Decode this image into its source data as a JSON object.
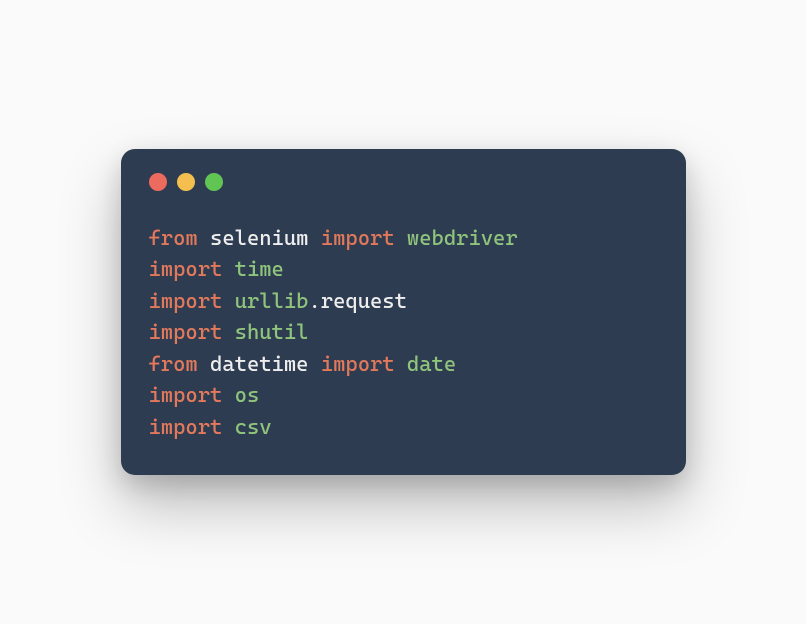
{
  "code": {
    "lines": [
      {
        "tokens": [
          {
            "t": "from ",
            "c": "keyword"
          },
          {
            "t": "selenium ",
            "c": "plain"
          },
          {
            "t": "import ",
            "c": "keyword"
          },
          {
            "t": "webdriver",
            "c": "module"
          }
        ]
      },
      {
        "tokens": [
          {
            "t": "import ",
            "c": "keyword"
          },
          {
            "t": "time",
            "c": "module"
          }
        ]
      },
      {
        "tokens": [
          {
            "t": "import ",
            "c": "keyword"
          },
          {
            "t": "urllib",
            "c": "module"
          },
          {
            "t": ".request",
            "c": "plain"
          }
        ]
      },
      {
        "tokens": [
          {
            "t": "import ",
            "c": "keyword"
          },
          {
            "t": "shutil",
            "c": "module"
          }
        ]
      },
      {
        "tokens": [
          {
            "t": "from ",
            "c": "keyword"
          },
          {
            "t": "datetime ",
            "c": "plain"
          },
          {
            "t": "import ",
            "c": "keyword"
          },
          {
            "t": "date",
            "c": "module"
          }
        ]
      },
      {
        "tokens": [
          {
            "t": "import ",
            "c": "keyword"
          },
          {
            "t": "os",
            "c": "module"
          }
        ]
      },
      {
        "tokens": [
          {
            "t": "import ",
            "c": "keyword"
          },
          {
            "t": "csv",
            "c": "module"
          }
        ]
      }
    ]
  },
  "window": {
    "traffic_lights": [
      "red",
      "yellow",
      "green"
    ]
  }
}
